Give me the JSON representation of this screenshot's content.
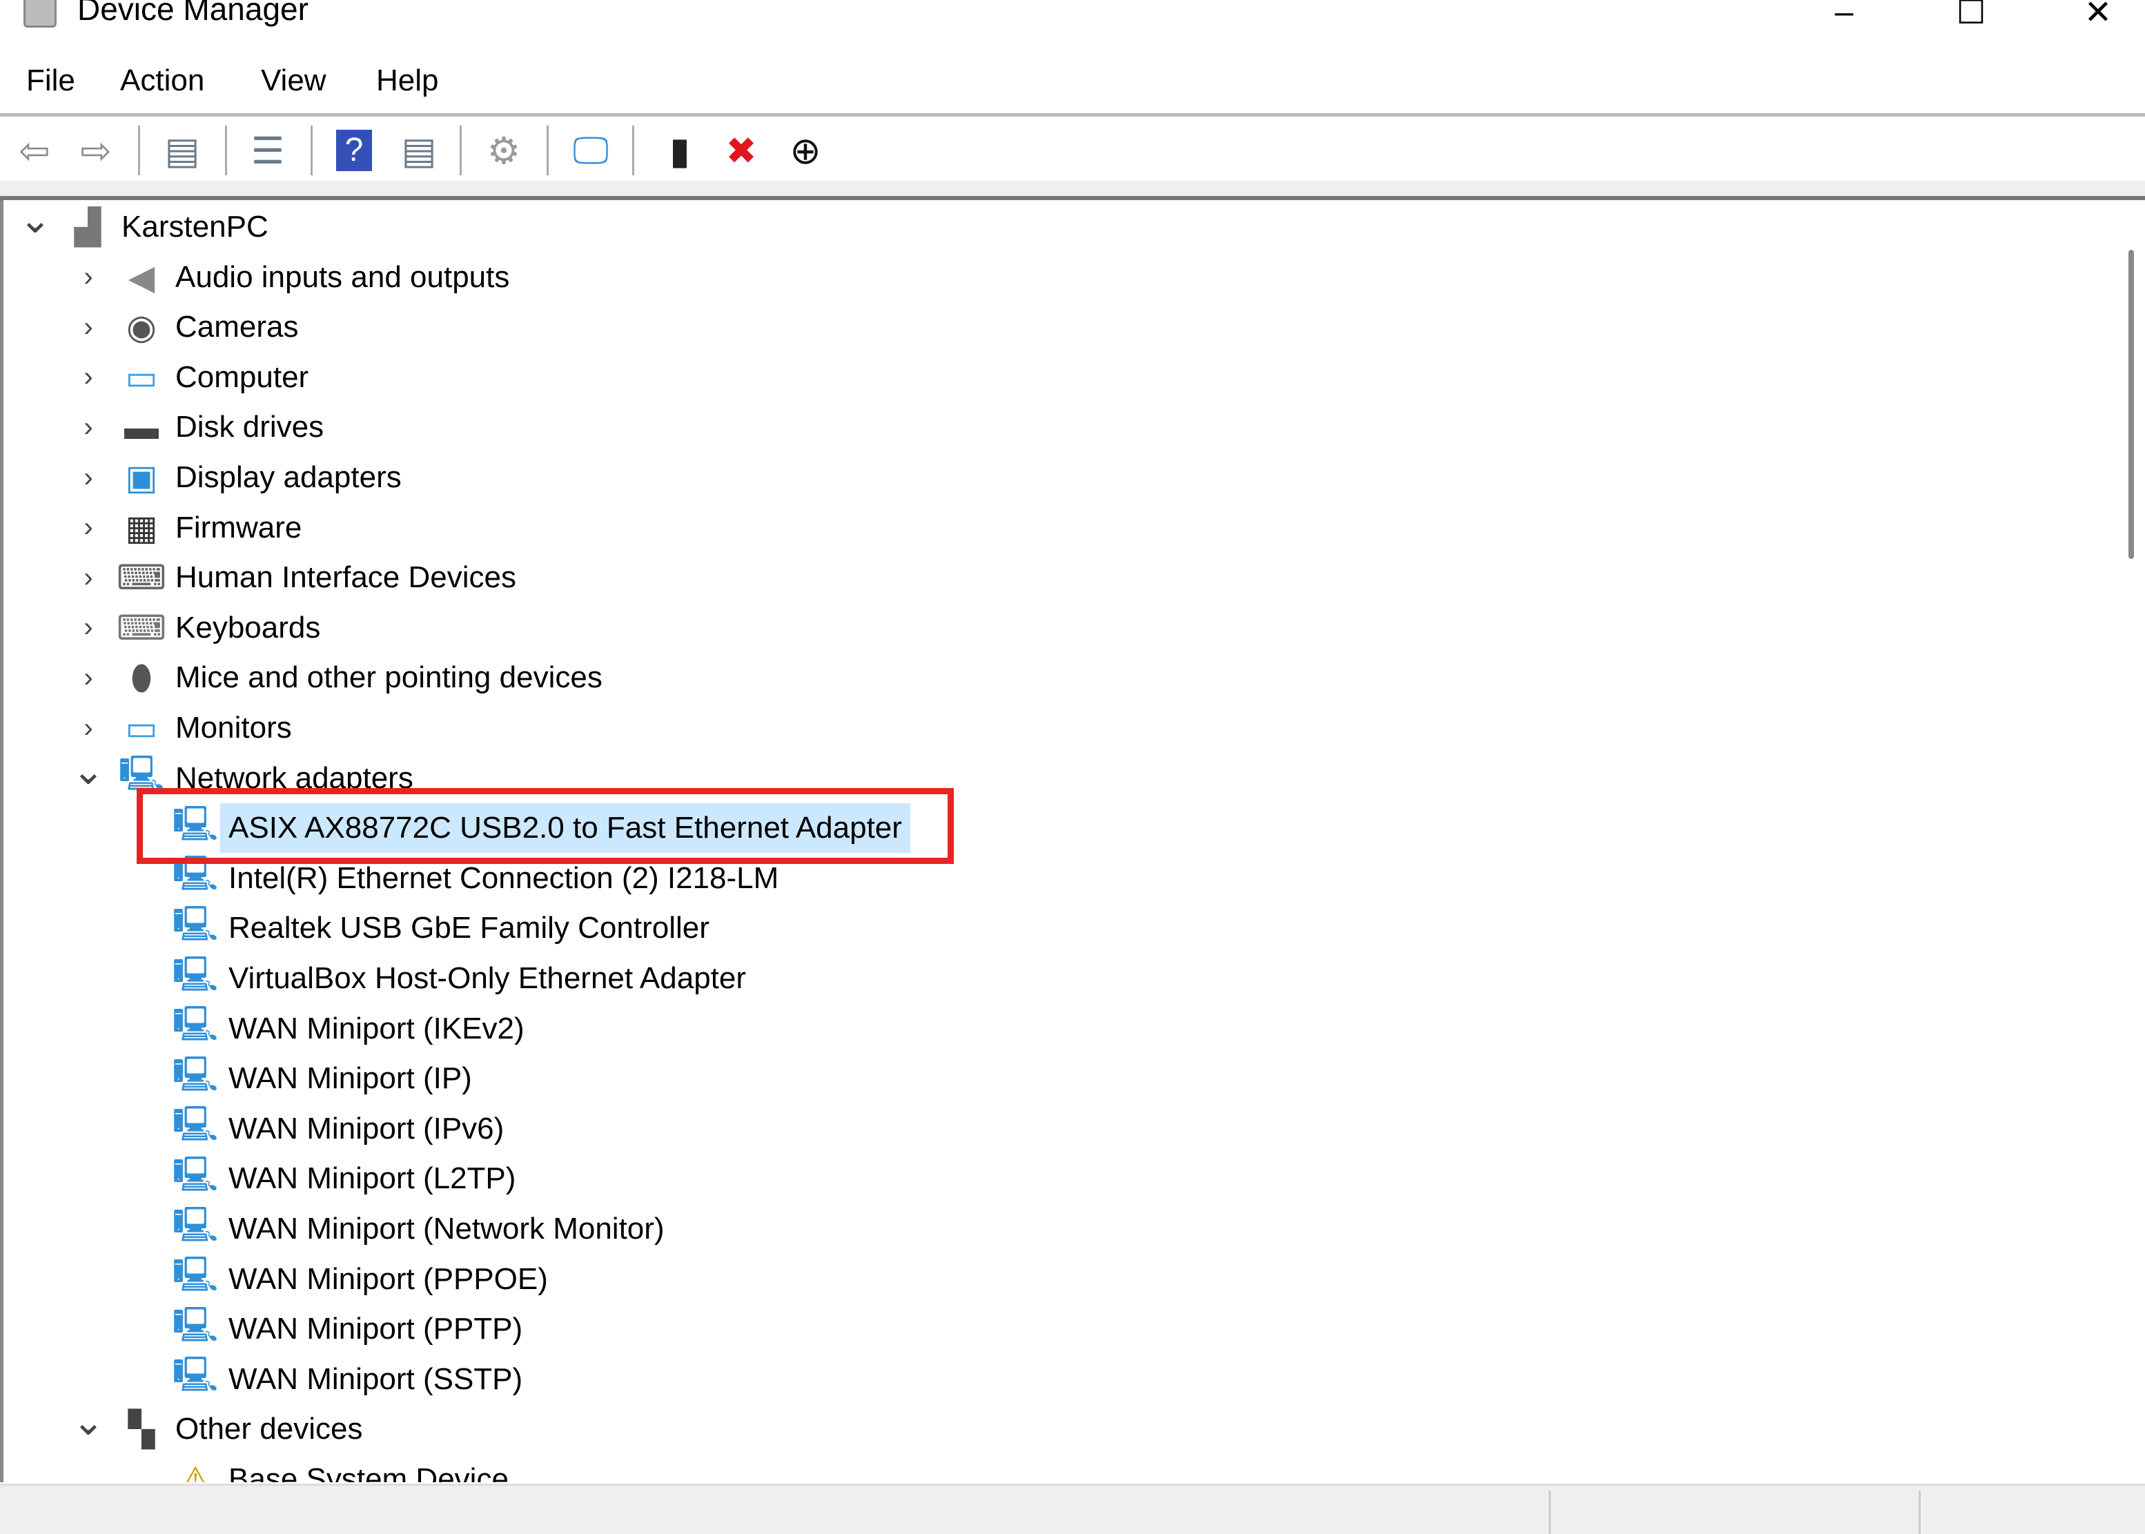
{
  "window": {
    "title": "Device Manager",
    "minimize": "–",
    "maximize": "☐",
    "close": "✕"
  },
  "menu": [
    "File",
    "Action",
    "View",
    "Help"
  ],
  "toolbar": [
    {
      "name": "back-icon",
      "glyph": "⇦",
      "color": "#8a8a8a"
    },
    {
      "name": "forward-icon",
      "glyph": "⇨",
      "color": "#8a8a8a"
    },
    {
      "name": "show-hide-console-tree-icon",
      "glyph": "▤",
      "color": "#6a7a8a"
    },
    {
      "name": "properties-icon",
      "glyph": "☰",
      "color": "#6a7a8a"
    },
    {
      "name": "help-icon",
      "glyph": "?",
      "color": "#ffffff"
    },
    {
      "name": "show-hide-action-pane-icon",
      "glyph": "▤",
      "color": "#6a7a8a"
    },
    {
      "name": "update-driver-icon",
      "glyph": "⚙",
      "color": "#999999"
    },
    {
      "name": "scan-hardware-changes-icon",
      "glyph": "🖵",
      "color": "#3a8fd8"
    },
    {
      "name": "enable-device-icon",
      "glyph": "▮",
      "color": "#222222"
    },
    {
      "name": "uninstall-device-icon",
      "glyph": "✖",
      "color": "#e0161b"
    },
    {
      "name": "disable-device-icon",
      "glyph": "⊕",
      "color": "#111111"
    }
  ],
  "tree": [
    {
      "label": "KarstenPC",
      "level": 0,
      "state": "expanded",
      "icon": "computer-root-icon"
    },
    {
      "label": "Audio inputs and outputs",
      "level": 1,
      "state": "collapsed",
      "icon": "speaker-icon"
    },
    {
      "label": "Cameras",
      "level": 1,
      "state": "collapsed",
      "icon": "camera-icon"
    },
    {
      "label": "Computer",
      "level": 1,
      "state": "collapsed",
      "icon": "monitor-icon"
    },
    {
      "label": "Disk drives",
      "level": 1,
      "state": "collapsed",
      "icon": "disk-drive-icon"
    },
    {
      "label": "Display adapters",
      "level": 1,
      "state": "collapsed",
      "icon": "display-adapter-icon"
    },
    {
      "label": "Firmware",
      "level": 1,
      "state": "collapsed",
      "icon": "firmware-chip-icon"
    },
    {
      "label": "Human Interface Devices",
      "level": 1,
      "state": "collapsed",
      "icon": "hid-icon"
    },
    {
      "label": "Keyboards",
      "level": 1,
      "state": "collapsed",
      "icon": "keyboard-icon"
    },
    {
      "label": "Mice and other pointing devices",
      "level": 1,
      "state": "collapsed",
      "icon": "mouse-icon"
    },
    {
      "label": "Monitors",
      "level": 1,
      "state": "collapsed",
      "icon": "monitor-icon"
    },
    {
      "label": "Network adapters",
      "level": 1,
      "state": "expanded",
      "icon": "network-adapter-icon"
    },
    {
      "label": "ASIX AX88772C USB2.0 to Fast Ethernet Adapter",
      "level": 2,
      "selected": true,
      "icon": "network-adapter-icon"
    },
    {
      "label": "Intel(R) Ethernet Connection (2) I218-LM",
      "level": 2,
      "icon": "network-adapter-icon"
    },
    {
      "label": "Realtek USB GbE Family Controller",
      "level": 2,
      "icon": "network-adapter-icon"
    },
    {
      "label": "VirtualBox Host-Only Ethernet Adapter",
      "level": 2,
      "icon": "network-adapter-icon"
    },
    {
      "label": "WAN Miniport (IKEv2)",
      "level": 2,
      "icon": "network-adapter-icon"
    },
    {
      "label": "WAN Miniport (IP)",
      "level": 2,
      "icon": "network-adapter-icon"
    },
    {
      "label": "WAN Miniport (IPv6)",
      "level": 2,
      "icon": "network-adapter-icon"
    },
    {
      "label": "WAN Miniport (L2TP)",
      "level": 2,
      "icon": "network-adapter-icon"
    },
    {
      "label": "WAN Miniport (Network Monitor)",
      "level": 2,
      "icon": "network-adapter-icon"
    },
    {
      "label": "WAN Miniport (PPPOE)",
      "level": 2,
      "icon": "network-adapter-icon"
    },
    {
      "label": "WAN Miniport (PPTP)",
      "level": 2,
      "icon": "network-adapter-icon"
    },
    {
      "label": "WAN Miniport (SSTP)",
      "level": 2,
      "icon": "network-adapter-icon"
    },
    {
      "label": "Other devices",
      "level": 1,
      "state": "expanded",
      "icon": "unknown-device-icon"
    },
    {
      "label": "Base System Device",
      "level": 2,
      "icon": "warning-device-icon"
    }
  ],
  "colors": {
    "selection": "#cce8ff",
    "highlight_box": "#e52521"
  }
}
